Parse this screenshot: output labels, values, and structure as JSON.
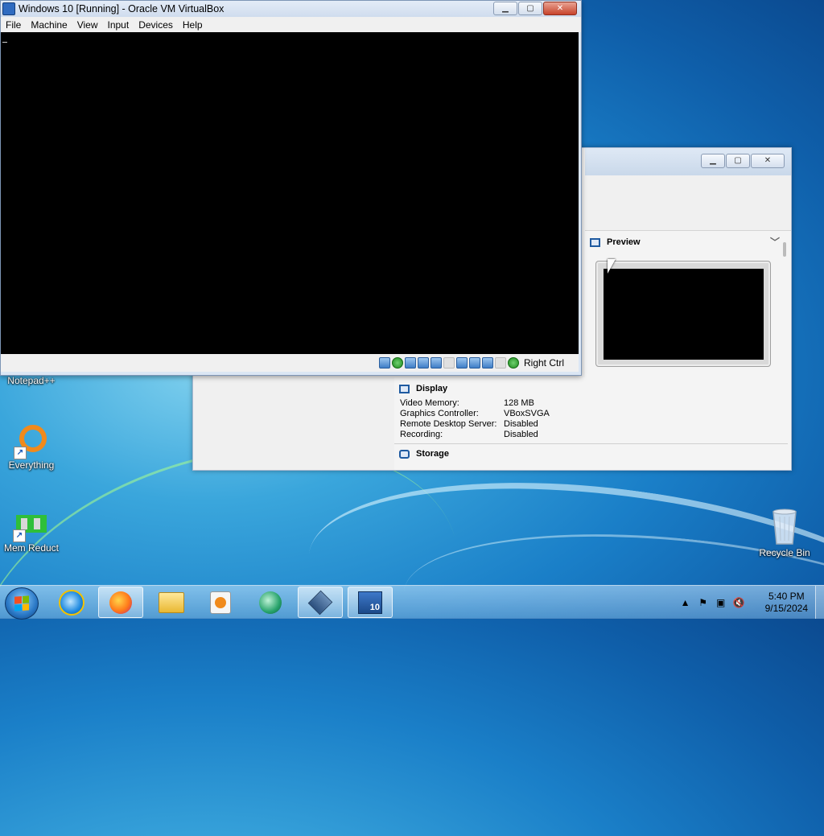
{
  "vm_window": {
    "title": "Windows 10 [Running] - Oracle VM VirtualBox",
    "menu": [
      "File",
      "Machine",
      "View",
      "Input",
      "Devices",
      "Help"
    ],
    "host_key": "Right Ctrl",
    "status_icons": [
      "hard-disk-icon",
      "optical-drive-icon",
      "audio-icon",
      "network-icon",
      "usb-icon",
      "shared-folders-icon",
      "display-icon",
      "video-capture-icon",
      "recording-icon",
      "cpu-icon",
      "mouse-integration-icon"
    ]
  },
  "manager_window": {
    "preview": {
      "title": "Preview"
    },
    "display": {
      "title": "Display",
      "properties": [
        {
          "key": "Video Memory:",
          "value": "128 MB"
        },
        {
          "key": "Graphics Controller:",
          "value": "VBoxSVGA"
        },
        {
          "key": "Remote Desktop Server:",
          "value": "Disabled"
        },
        {
          "key": "Recording:",
          "value": "Disabled"
        }
      ]
    },
    "storage": {
      "title": "Storage"
    }
  },
  "desktop_icons": [
    {
      "label": "Notepad++"
    },
    {
      "label": "Everything"
    },
    {
      "label": "Mem Reduct"
    },
    {
      "label": "Recycle Bin"
    }
  ],
  "taskbar": {
    "pinned": [
      "internet-explorer-icon",
      "firefox-icon",
      "file-explorer-icon",
      "media-player-icon",
      "mpc-player-icon",
      "virtualbox-icon",
      "windows-10-vm-icon"
    ],
    "clock": {
      "time": "5:40 PM",
      "date": "9/15/2024"
    }
  },
  "colors": {
    "vm_screen": "#000000",
    "desktop": "#1a7fc8",
    "close_button": "#c7432b"
  }
}
